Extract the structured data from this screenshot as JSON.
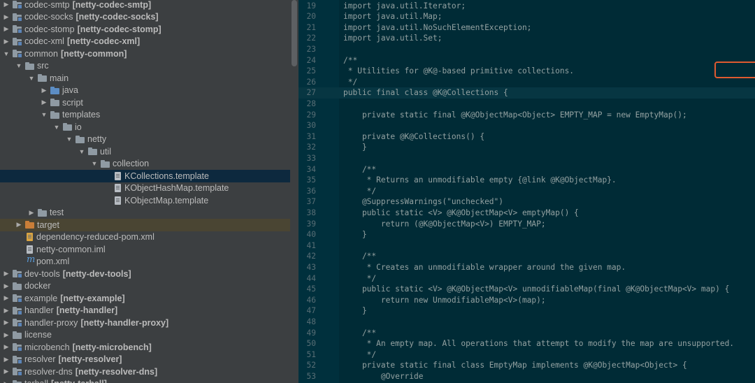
{
  "tree": {
    "rows": [
      {
        "indent": 1,
        "arrow": "right",
        "kind": "module",
        "label": "codec-smtp",
        "module": "[netty-codec-smtp]"
      },
      {
        "indent": 1,
        "arrow": "right",
        "kind": "module",
        "label": "codec-socks",
        "module": "[netty-codec-socks]"
      },
      {
        "indent": 1,
        "arrow": "right",
        "kind": "module",
        "label": "codec-stomp",
        "module": "[netty-codec-stomp]"
      },
      {
        "indent": 1,
        "arrow": "right",
        "kind": "module",
        "label": "codec-xml",
        "module": "[netty-codec-xml]"
      },
      {
        "indent": 1,
        "arrow": "down",
        "kind": "module",
        "label": "common",
        "module": "[netty-common]"
      },
      {
        "indent": 2,
        "arrow": "down",
        "kind": "folder",
        "label": "src",
        "module": ""
      },
      {
        "indent": 3,
        "arrow": "down",
        "kind": "folder",
        "label": "main",
        "module": ""
      },
      {
        "indent": 4,
        "arrow": "right",
        "kind": "java",
        "label": "java",
        "module": ""
      },
      {
        "indent": 4,
        "arrow": "right",
        "kind": "folder",
        "label": "script",
        "module": ""
      },
      {
        "indent": 4,
        "arrow": "down",
        "kind": "folder",
        "label": "templates",
        "module": ""
      },
      {
        "indent": 5,
        "arrow": "down",
        "kind": "folder",
        "label": "io",
        "module": ""
      },
      {
        "indent": 6,
        "arrow": "down",
        "kind": "folder",
        "label": "netty",
        "module": ""
      },
      {
        "indent": 7,
        "arrow": "down",
        "kind": "folder",
        "label": "util",
        "module": ""
      },
      {
        "indent": 8,
        "arrow": "down",
        "kind": "folder",
        "label": "collection",
        "module": ""
      },
      {
        "indent": 9,
        "arrow": "none",
        "kind": "file",
        "label": "KCollections.template",
        "module": "",
        "selected": true
      },
      {
        "indent": 9,
        "arrow": "none",
        "kind": "file",
        "label": "KObjectHashMap.template",
        "module": ""
      },
      {
        "indent": 9,
        "arrow": "none",
        "kind": "file",
        "label": "KObjectMap.template",
        "module": ""
      },
      {
        "indent": 3,
        "arrow": "right",
        "kind": "folder",
        "label": "test",
        "module": ""
      },
      {
        "indent": 2,
        "arrow": "right",
        "kind": "target",
        "label": "target",
        "module": "",
        "excluded": true
      },
      {
        "indent": 2,
        "arrow": "none",
        "kind": "xml",
        "label": "dependency-reduced-pom.xml",
        "module": ""
      },
      {
        "indent": 2,
        "arrow": "none",
        "kind": "file",
        "label": "netty-common.iml",
        "module": ""
      },
      {
        "indent": 2,
        "arrow": "none",
        "kind": "pom",
        "label": "pom.xml",
        "module": ""
      },
      {
        "indent": 1,
        "arrow": "right",
        "kind": "module",
        "label": "dev-tools",
        "module": "[netty-dev-tools]"
      },
      {
        "indent": 1,
        "arrow": "right",
        "kind": "folder",
        "label": "docker",
        "module": ""
      },
      {
        "indent": 1,
        "arrow": "right",
        "kind": "module",
        "label": "example",
        "module": "[netty-example]"
      },
      {
        "indent": 1,
        "arrow": "right",
        "kind": "module",
        "label": "handler",
        "module": "[netty-handler]"
      },
      {
        "indent": 1,
        "arrow": "right",
        "kind": "module",
        "label": "handler-proxy",
        "module": "[netty-handler-proxy]"
      },
      {
        "indent": 1,
        "arrow": "right",
        "kind": "folder",
        "label": "license",
        "module": ""
      },
      {
        "indent": 1,
        "arrow": "right",
        "kind": "module",
        "label": "microbench",
        "module": "[netty-microbench]"
      },
      {
        "indent": 1,
        "arrow": "right",
        "kind": "module",
        "label": "resolver",
        "module": "[netty-resolver]"
      },
      {
        "indent": 1,
        "arrow": "right",
        "kind": "module",
        "label": "resolver-dns",
        "module": "[netty-resolver-dns]"
      },
      {
        "indent": 1,
        "arrow": "right",
        "kind": "module",
        "label": "tarball",
        "module": "[netty-tarball]"
      }
    ]
  },
  "editor": {
    "lines": [
      {
        "n": "19",
        "text": "import java.util.Iterator;"
      },
      {
        "n": "20",
        "text": "import java.util.Map;"
      },
      {
        "n": "21",
        "text": "import java.util.NoSuchElementException;"
      },
      {
        "n": "22",
        "text": "import java.util.Set;"
      },
      {
        "n": "23",
        "text": ""
      },
      {
        "n": "24",
        "text": "/**"
      },
      {
        "n": "25",
        "text": " * Utilities for @K@-based primitive collections."
      },
      {
        "n": "26",
        "text": " */"
      },
      {
        "n": "27",
        "text": "public final class @K@Collections {",
        "current": true
      },
      {
        "n": "28",
        "text": ""
      },
      {
        "n": "29",
        "text": "    private static final @K@ObjectMap<Object> EMPTY_MAP = new EmptyMap();"
      },
      {
        "n": "30",
        "text": ""
      },
      {
        "n": "31",
        "text": "    private @K@Collections() {"
      },
      {
        "n": "32",
        "text": "    }"
      },
      {
        "n": "33",
        "text": ""
      },
      {
        "n": "34",
        "text": "    /**"
      },
      {
        "n": "35",
        "text": "     * Returns an unmodifiable empty {@link @K@ObjectMap}."
      },
      {
        "n": "36",
        "text": "     */"
      },
      {
        "n": "37",
        "text": "    @SuppressWarnings(\"unchecked\")"
      },
      {
        "n": "38",
        "text": "    public static <V> @K@ObjectMap<V> emptyMap() {"
      },
      {
        "n": "39",
        "text": "        return (@K@ObjectMap<V>) EMPTY_MAP;"
      },
      {
        "n": "40",
        "text": "    }"
      },
      {
        "n": "41",
        "text": ""
      },
      {
        "n": "42",
        "text": "    /**"
      },
      {
        "n": "43",
        "text": "     * Creates an unmodifiable wrapper around the given map."
      },
      {
        "n": "44",
        "text": "     */"
      },
      {
        "n": "45",
        "text": "    public static <V> @K@ObjectMap<V> unmodifiableMap(final @K@ObjectMap<V> map) {"
      },
      {
        "n": "46",
        "text": "        return new UnmodifiableMap<V>(map);"
      },
      {
        "n": "47",
        "text": "    }"
      },
      {
        "n": "48",
        "text": ""
      },
      {
        "n": "49",
        "text": "    /**"
      },
      {
        "n": "50",
        "text": "     * An empty map. All operations that attempt to modify the map are unsupported."
      },
      {
        "n": "51",
        "text": "     */"
      },
      {
        "n": "52",
        "text": "    private static final class EmptyMap implements @K@ObjectMap<Object> {"
      },
      {
        "n": "53",
        "text": "        @Override"
      }
    ]
  }
}
